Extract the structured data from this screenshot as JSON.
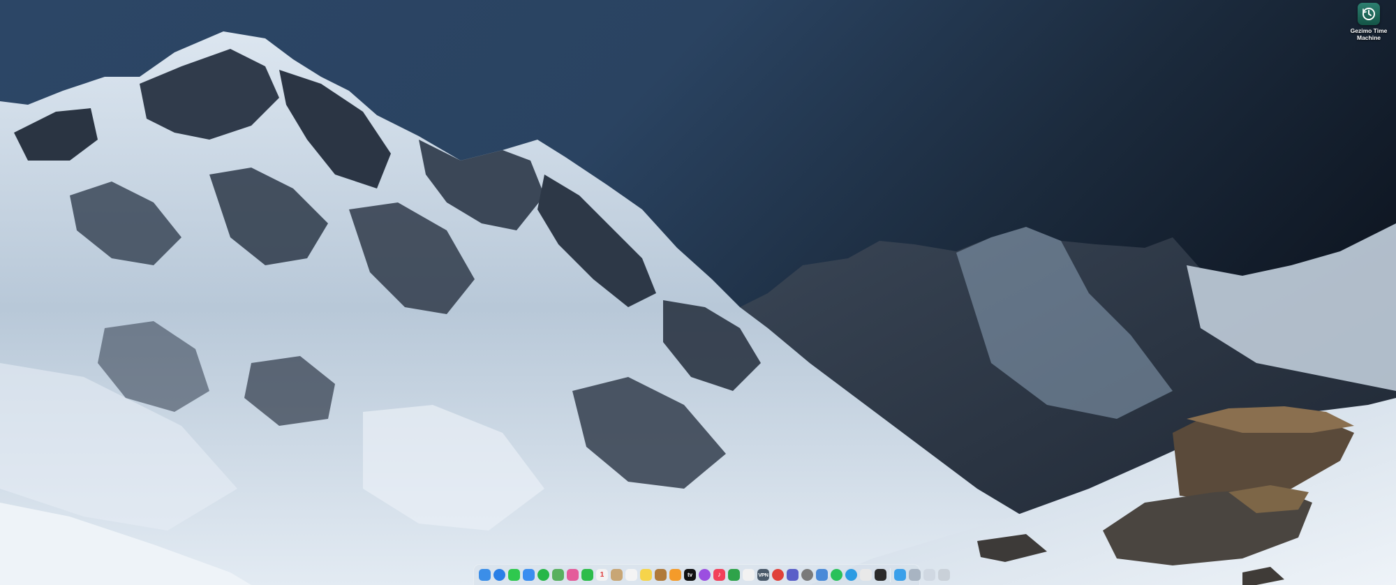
{
  "desktop": {
    "wallpaper": "mountain-landscape",
    "icons": [
      {
        "name": "time-machine-icon",
        "label": "Gezimo Time Machine"
      }
    ]
  },
  "dock": {
    "apps": [
      {
        "name": "finder-icon",
        "glyph": "",
        "color": "#3b8ee8"
      },
      {
        "name": "safari-icon",
        "glyph": "",
        "color": "#2a7fe6"
      },
      {
        "name": "messages-icon",
        "glyph": "",
        "color": "#2fc84e"
      },
      {
        "name": "mail-icon",
        "glyph": "",
        "color": "#3a8ef0"
      },
      {
        "name": "facetime-icon",
        "glyph": "",
        "color": "#27b748"
      },
      {
        "name": "maps-icon",
        "glyph": "",
        "color": "#58b05f"
      },
      {
        "name": "photos-icon",
        "glyph": "",
        "color": "#e45c9a"
      },
      {
        "name": "facetime-video-icon",
        "glyph": "",
        "color": "#2dbc4a"
      },
      {
        "name": "calendar-icon",
        "glyph": "1",
        "color": "#f3f3f3"
      },
      {
        "name": "contacts-icon",
        "glyph": "",
        "color": "#c8a675"
      },
      {
        "name": "reminders-icon",
        "glyph": "",
        "color": "#f4f4f4"
      },
      {
        "name": "notes-icon",
        "glyph": "",
        "color": "#f6d44a"
      },
      {
        "name": "freeform-icon",
        "glyph": "",
        "color": "#b07a3a"
      },
      {
        "name": "home-icon",
        "glyph": "",
        "color": "#f49b2a"
      },
      {
        "name": "apple-tv-icon",
        "glyph": "tv",
        "color": "#111111"
      },
      {
        "name": "podcasts-icon",
        "glyph": "",
        "color": "#9b4fe0"
      },
      {
        "name": "music-icon",
        "glyph": "♪",
        "color": "#f2415a"
      },
      {
        "name": "numbers-icon",
        "glyph": "",
        "color": "#2ea34a"
      },
      {
        "name": "pages-icon",
        "glyph": "",
        "color": "#f2f2f2"
      },
      {
        "name": "vpn-icon",
        "glyph": "VPN",
        "color": "#4a5a6a"
      },
      {
        "name": "toolbox-icon",
        "glyph": "",
        "color": "#e0413a"
      },
      {
        "name": "teams-icon",
        "glyph": "",
        "color": "#5a5fc8"
      },
      {
        "name": "settings-icon",
        "glyph": "",
        "color": "#7a7a7a"
      },
      {
        "name": "screen-sharing-icon",
        "glyph": "",
        "color": "#4a8ad8"
      },
      {
        "name": "whatsapp-icon",
        "glyph": "",
        "color": "#29c15a"
      },
      {
        "name": "telegram-icon",
        "glyph": "",
        "color": "#2a9be3"
      },
      {
        "name": "textedit-icon",
        "glyph": "",
        "color": "#e9e9e9"
      },
      {
        "name": "iphone-mirroring-icon",
        "glyph": "",
        "color": "#2b2b2b"
      }
    ],
    "extras": [
      {
        "name": "downloads-stack-icon",
        "glyph": "",
        "color": "#3aa0ea"
      },
      {
        "name": "screenshots-stack-icon",
        "glyph": "",
        "color": "#a8b4c2"
      },
      {
        "name": "documents-stack-icon",
        "glyph": "",
        "color": "#d0d8e2"
      },
      {
        "name": "trash-icon",
        "glyph": "",
        "color": "#c9d0d8"
      }
    ]
  }
}
